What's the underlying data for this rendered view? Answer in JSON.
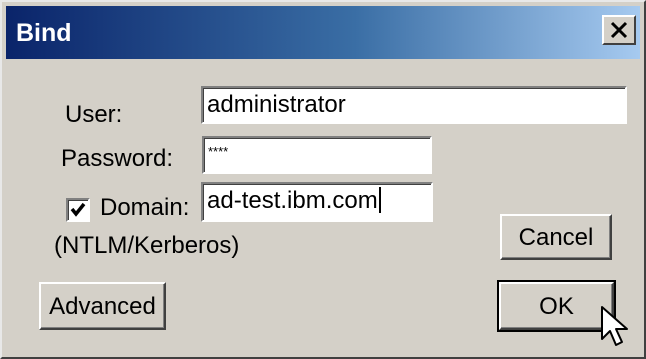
{
  "window": {
    "title": "Bind",
    "close_icon": "close-icon"
  },
  "form": {
    "user_label": "User:",
    "user_value": "administrator",
    "password_label": "Password:",
    "password_value": "****",
    "domain_checked": true,
    "domain_label": "Domain:",
    "domain_value": "ad-test.ibm.com",
    "domain_note": "(NTLM/Kerberos)"
  },
  "buttons": {
    "cancel": "Cancel",
    "advanced": "Advanced",
    "ok": "OK"
  },
  "colors": {
    "title_start": "#0a246a",
    "title_end": "#a6caf0",
    "face": "#d4d0c8"
  }
}
